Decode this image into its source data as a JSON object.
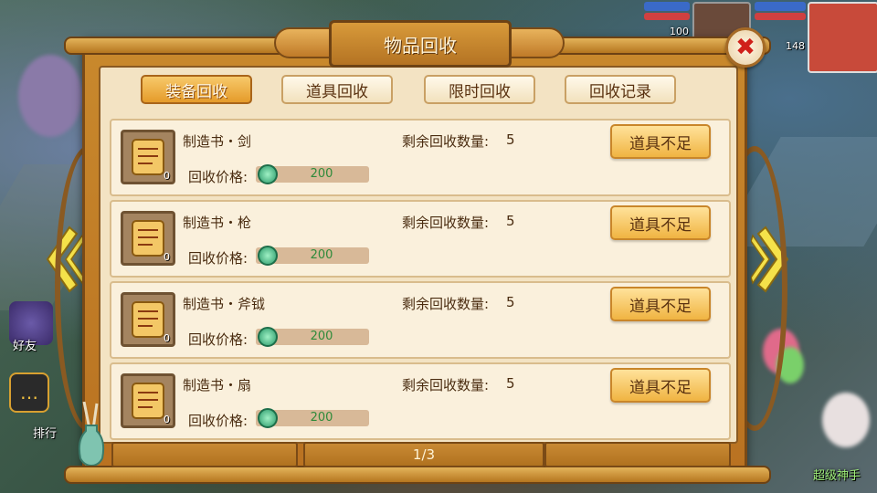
{
  "window": {
    "title": "物品回收",
    "close_icon": "close-x-icon",
    "accent_color": "#d0201a"
  },
  "tabs": [
    {
      "label": "装备回收",
      "active": true
    },
    {
      "label": "道具回收",
      "active": false
    },
    {
      "label": "限时回收",
      "active": false
    },
    {
      "label": "回收记录",
      "active": false
    }
  ],
  "items": [
    {
      "name": "制造书・剑",
      "count": "0",
      "price_label": "回收价格:",
      "price": "200",
      "remain_label": "剩余回收数量:",
      "remain": "5",
      "button": "道具不足"
    },
    {
      "name": "制造书・枪",
      "count": "0",
      "price_label": "回收价格:",
      "price": "200",
      "remain_label": "剩余回收数量:",
      "remain": "5",
      "button": "道具不足"
    },
    {
      "name": "制造书・斧钺",
      "count": "0",
      "price_label": "回收价格:",
      "price": "200",
      "remain_label": "剩余回收数量:",
      "remain": "5",
      "button": "道具不足"
    },
    {
      "name": "制造书・扇",
      "count": "0",
      "price_label": "回收价格:",
      "price": "200",
      "remain_label": "剩余回收数量:",
      "remain": "5",
      "button": "道具不足"
    }
  ],
  "pagination": {
    "text": "1/3"
  },
  "hud": {
    "friends_label": "好友",
    "ranking_label": "排行",
    "top_left_value": "100",
    "top_right_value": "148",
    "right_label": "超级神手",
    "chat_icon": "chat-bubble-icon",
    "friends_icon": "wizard-hat-icon",
    "left_arrow_icon": "page-left-arrow-icon",
    "right_arrow_icon": "page-right-arrow-icon",
    "coin_icon": "jade-coin-icon",
    "scroll_icon": "recipe-scroll-icon"
  }
}
